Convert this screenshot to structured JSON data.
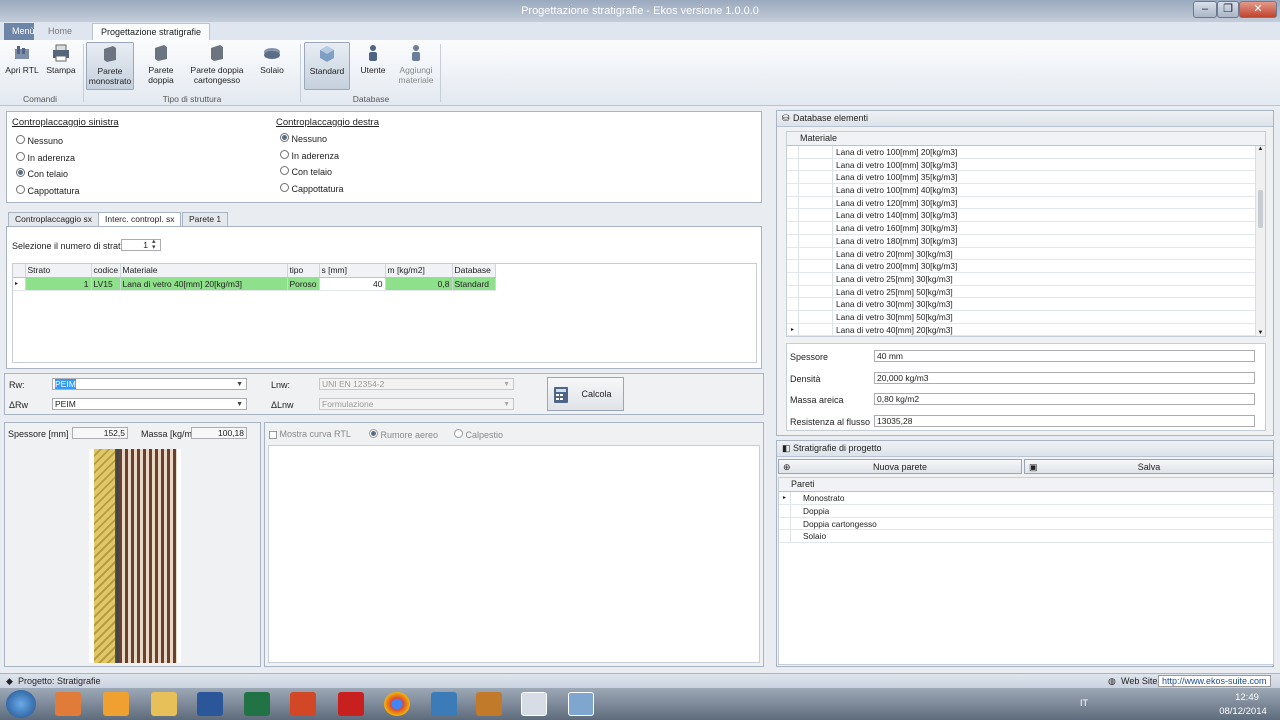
{
  "window": {
    "title": "Progettazione stratigrafie - Ekos versione 1.0.0.0",
    "controls": [
      "–",
      "❐",
      "✕"
    ]
  },
  "ribbon": {
    "tabs": [
      "Menù",
      "Home",
      "Progettazione stratigrafie"
    ],
    "groups": {
      "comandi": {
        "label": "Comandi",
        "buttons": [
          "Apri RTL",
          "Stampa"
        ]
      },
      "tipo": {
        "label": "Tipo di struttura",
        "buttons": [
          "Parete monostrato",
          "Parete doppia",
          "Parete doppia cartongesso",
          "Solaio"
        ]
      },
      "database": {
        "label": "Database",
        "buttons": [
          "Standard",
          "Utente",
          "Aggiungi materiale"
        ]
      }
    }
  },
  "contro_sx": {
    "title": "Controplaccaggio sinistra",
    "options": [
      "Nessuno",
      "In aderenza",
      "Con telaio",
      "Cappottatura"
    ],
    "selected": 2
  },
  "contro_dx": {
    "title": "Controplaccaggio destra",
    "options": [
      "Nessuno",
      "In aderenza",
      "Con telaio",
      "Cappottatura"
    ],
    "selected": 0
  },
  "layers": {
    "tabs": [
      "Controplaccaggio sx",
      "Interc. contropl. sx",
      "Parete 1"
    ],
    "active_tab": 1,
    "count_label": "Selezione il numero di strati",
    "count_value": "1",
    "columns": [
      "Strato",
      "codice",
      "Materiale",
      "tipo",
      "s [mm]",
      "m [kg/m2]",
      "Database"
    ],
    "rows": [
      [
        "1",
        "LV15",
        "Lana di vetro 40[mm] 20[kg/m3]",
        "Poroso",
        "40",
        "0,8",
        "Standard"
      ]
    ]
  },
  "calc": {
    "rw_label": "Rw:",
    "rw_value": "PEIM",
    "drw_label": "ΔRw",
    "drw_value": "PEIM",
    "lnw_label": "Lnw:",
    "lnw_value": "UNI EN 12354-2",
    "dlnw_label": "ΔLnw",
    "dlnw_value": "Formulazione",
    "calcola": "Calcola"
  },
  "summary": {
    "spessore_label": "Spessore [mm]",
    "spessore_value": "152,5",
    "massa_label": "Massa [kg/m",
    "massa_value": "100,18",
    "mostra_curva": "Mostra curva RTL",
    "rumore": "Rumore aereo",
    "calpestio": "Calpestio"
  },
  "db": {
    "title": "Database elementi",
    "column": "Materiale",
    "items": [
      "Lana di vetro 100[mm] 20[kg/m3]",
      "Lana di vetro 100[mm] 30[kg/m3]",
      "Lana di vetro 100[mm] 35[kg/m3]",
      "Lana di vetro 100[mm] 40[kg/m3]",
      "Lana di vetro 120[mm] 30[kg/m3]",
      "Lana di vetro 140[mm] 30[kg/m3]",
      "Lana di vetro 160[mm] 30[kg/m3]",
      "Lana di vetro 180[mm] 30[kg/m3]",
      "Lana di vetro 20[mm] 30[kg/m3]",
      "Lana di vetro 200[mm] 30[kg/m3]",
      "Lana di vetro 25[mm] 30[kg/m3]",
      "Lana di vetro 25[mm] 50[kg/m3]",
      "Lana di vetro 30[mm] 30[kg/m3]",
      "Lana di vetro 30[mm] 50[kg/m3]",
      "Lana di vetro 40[mm] 20[kg/m3]"
    ],
    "props": [
      {
        "label": "Spessore",
        "value": "40 mm"
      },
      {
        "label": "Densità",
        "value": "20,000 kg/m3"
      },
      {
        "label": "Massa areica",
        "value": "0,80 kg/m2"
      },
      {
        "label": "Resistenza al flusso",
        "value": "13035,28"
      }
    ]
  },
  "strat": {
    "title": "Stratigrafie di progetto",
    "nuova": "Nuova parete",
    "salva": "Salva",
    "column": "Pareti",
    "items": [
      "Monostrato",
      "Doppia",
      "Doppia cartongesso",
      "Solaio"
    ]
  },
  "status": {
    "left": "Progetto: Stratigrafie",
    "web_label": "Web Site",
    "web_url": "http://www.ekos-suite.com"
  },
  "taskbar": {
    "lang": "IT",
    "time": "12:49",
    "date": "08/12/2014"
  }
}
